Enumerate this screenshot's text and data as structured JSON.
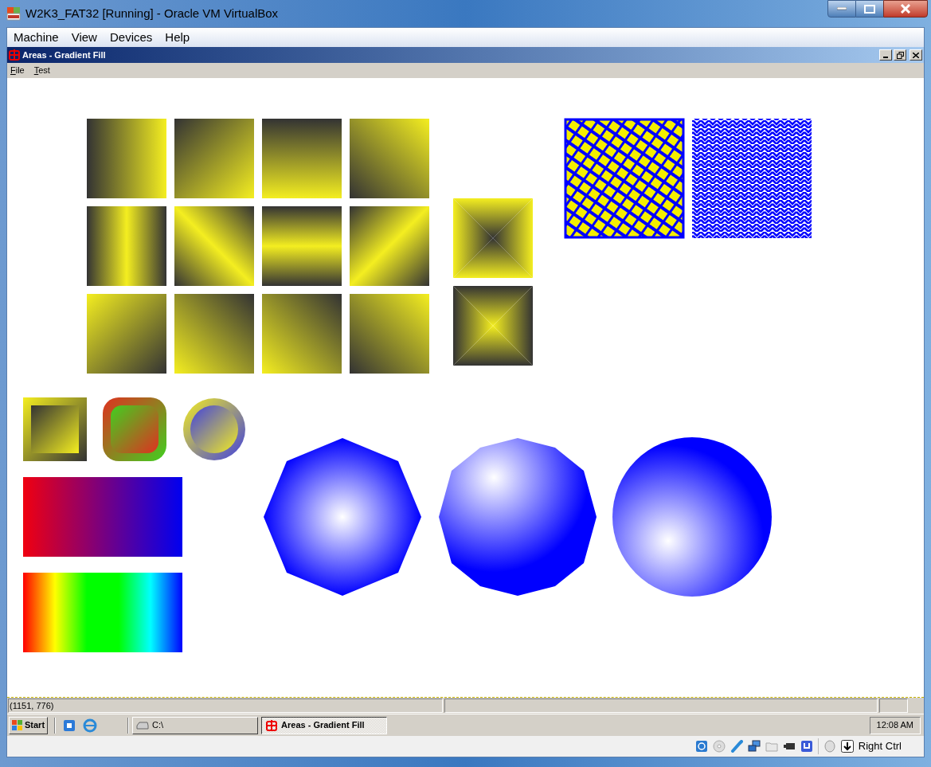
{
  "window": {
    "title": "W2K3_FAT32 [Running] - Oracle VM VirtualBox"
  },
  "menu": [
    "Machine",
    "View",
    "Devices",
    "Help"
  ],
  "child_window": {
    "title": "Areas - Gradient Fill",
    "menu": [
      "File",
      "Test"
    ]
  },
  "status_bar": {
    "panes": [
      "(1151, 776)"
    ]
  },
  "taskbar": {
    "start": "Start",
    "tasks": [
      {
        "label": "C:\\",
        "kind": "drive",
        "selected": false
      },
      {
        "label": "Areas - Gradient Fill",
        "kind": "app",
        "selected": true
      }
    ],
    "clock": "12:08 AM"
  },
  "vbox_status": {
    "host_key": "Right Ctrl"
  }
}
